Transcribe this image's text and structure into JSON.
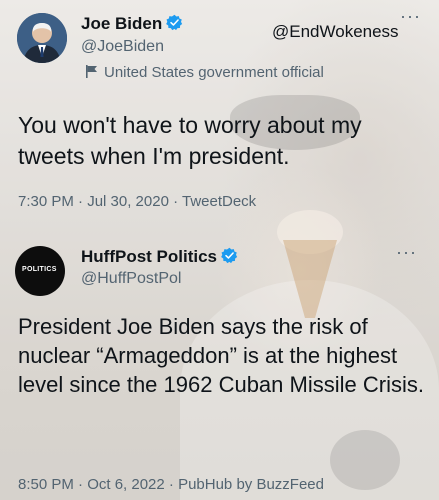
{
  "watermark": "@EndWokeness",
  "tweets": [
    {
      "name": "Joe Biden",
      "handle": "@JoeBiden",
      "label": "United States government official",
      "text": "You won't have to worry about my tweets when I'm president.",
      "meta": "7:30 PM · Jul 30, 2020 · TweetDeck",
      "more": "···"
    },
    {
      "name": "HuffPost Politics",
      "handle": "@HuffPostPol",
      "avatar_text": "POLITICS",
      "text": "President Joe Biden says the risk of nuclear “Armageddon” is at the highest level since the 1962 Cuban Missile Crisis.",
      "meta": "8:50 PM · Oct 6, 2022 · PubHub by BuzzFeed",
      "more": "···"
    }
  ],
  "colors": {
    "verified": "#1d9bf0",
    "secondary_text": "#536471",
    "primary_text": "#0f1419"
  },
  "icons": [
    "verified-badge-icon",
    "government-flag-icon",
    "more-options-icon"
  ]
}
